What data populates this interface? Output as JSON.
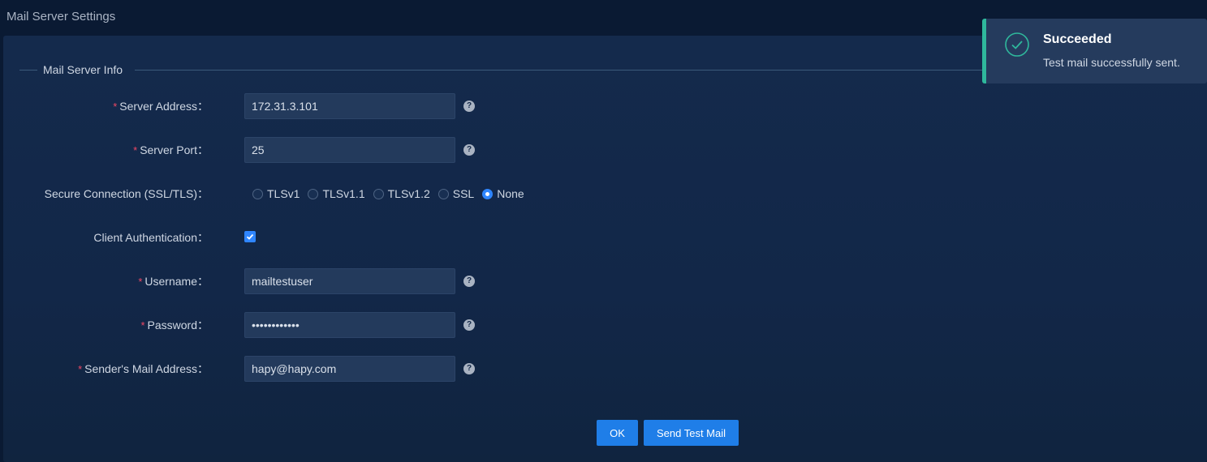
{
  "page": {
    "title": "Mail Server Settings"
  },
  "section": {
    "legend": "Mail Server Info"
  },
  "fields": {
    "server_address": {
      "label": "Server Address：",
      "value": "172.31.3.101",
      "required": "*"
    },
    "server_port": {
      "label": "Server Port：",
      "value": "25",
      "required": "*"
    },
    "secure_connection": {
      "label": "Secure Connection (SSL/TLS)：",
      "options": [
        "TLSv1",
        "TLSv1.1",
        "TLSv1.2",
        "SSL",
        "None"
      ],
      "selected": "None"
    },
    "client_auth": {
      "label": "Client Authentication：",
      "checked": true
    },
    "username": {
      "label": "Username：",
      "value": "mailtestuser",
      "required": "*"
    },
    "password": {
      "label": "Password：",
      "value": "••••••••••••",
      "required": "*"
    },
    "sender": {
      "label": "Sender's Mail Address：",
      "value": "hapy@hapy.com",
      "required": "*"
    }
  },
  "help_icon": "?",
  "buttons": {
    "ok": "OK",
    "send_test": "Send Test Mail"
  },
  "toast": {
    "title": "Succeeded",
    "message": "Test mail successfully sent.",
    "accent": "#2fb89c"
  },
  "colors": {
    "primary": "#1f7ee8",
    "required": "#f04864",
    "background": "#0a1a33"
  }
}
